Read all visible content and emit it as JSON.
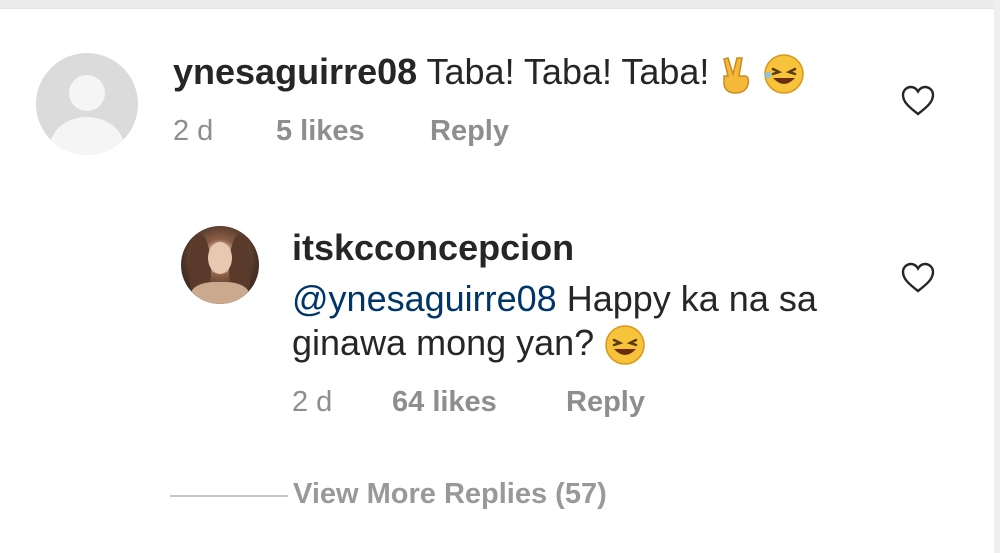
{
  "comments": [
    {
      "username": "ynesaguirre08",
      "text": "Taba! Taba! Taba!",
      "emoji_names": [
        "victory-hand-emoji",
        "laughing-face-emoji"
      ],
      "time": "2 d",
      "likes": "5 likes",
      "reply_label": "Reply"
    }
  ],
  "replies": [
    {
      "username": "itskcconcepcion",
      "mention": "@ynesaguirre08",
      "text_line1": "Happy ka na sa",
      "text_line2": "ginawa mong yan?",
      "emoji_names": [
        "grinning-squint-emoji"
      ],
      "time": "2 d",
      "likes": "64 likes",
      "reply_label": "Reply"
    }
  ],
  "view_more_label": "View More Replies (57)",
  "colors": {
    "text": "#262626",
    "secondary": "#8e8e8e",
    "mention": "#003569",
    "emoji": "#f7c33b"
  }
}
